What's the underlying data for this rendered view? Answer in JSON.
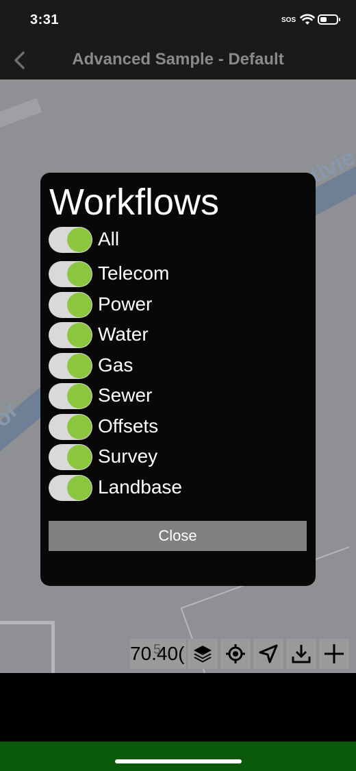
{
  "status_bar": {
    "time": "3:31",
    "sos": "SOS"
  },
  "nav": {
    "title": "Advanced Sample - Default"
  },
  "map": {
    "road_label_right": "tivie",
    "road_label_left": "or"
  },
  "modal": {
    "title": "Workflows",
    "toggles": [
      {
        "label": "All",
        "on": true
      },
      {
        "label": "Telecom",
        "on": true
      },
      {
        "label": "Power",
        "on": true
      },
      {
        "label": "Water",
        "on": true
      },
      {
        "label": "Gas",
        "on": true
      },
      {
        "label": "Sewer",
        "on": true
      },
      {
        "label": "Offsets",
        "on": true
      },
      {
        "label": "Survey",
        "on": true
      },
      {
        "label": "Landbase",
        "on": true
      }
    ],
    "close_label": "Close"
  },
  "toolbar": {
    "scale": "70.40(",
    "scale_overlay": "5"
  },
  "colors": {
    "toggle_on": "#8cc63f",
    "modal_bg": "#080808",
    "bottom_band": "#0b5a0b"
  }
}
